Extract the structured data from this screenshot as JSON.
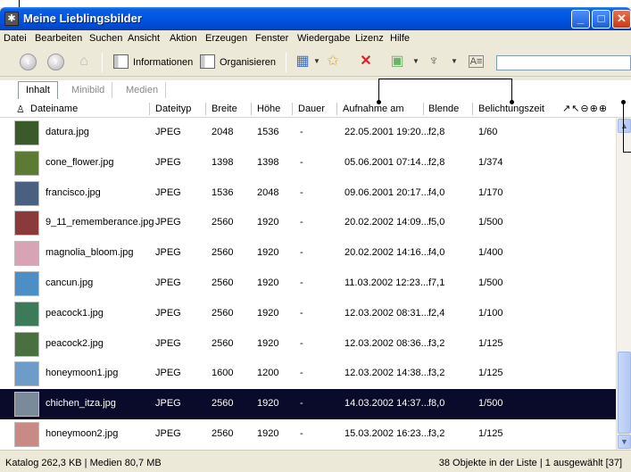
{
  "window": {
    "title": "Meine Lieblingsbilder",
    "title_icon": "✱",
    "controls": {
      "minimize": "_",
      "maximize": "□",
      "close": "✕"
    }
  },
  "menu": [
    "Datei",
    "Bearbeiten",
    "Suchen",
    "Ansicht",
    "Aktion",
    "Erzeugen",
    "Fenster",
    "Wiedergabe",
    "Lizenz",
    "Hilfe"
  ],
  "toolbar": {
    "info_label": "Informationen",
    "organize_label": "Organisieren",
    "icons": [
      "back-icon",
      "forward-icon",
      "home-icon",
      "calendar-icon",
      "folder-star-icon",
      "delete-icon",
      "lock-icon",
      "microphone-icon",
      "caption-icon"
    ]
  },
  "tabs": [
    "Inhalt",
    "Minibild",
    "Medien"
  ],
  "columns": [
    "Dateiname",
    "Dateityp",
    "Breite",
    "Höhe",
    "Dauer",
    "Aufnahme am",
    "Blende",
    "Belichtungszeit"
  ],
  "header_tools": "↗↖⊖⊕⊕",
  "rows": [
    {
      "name": "datura.jpg",
      "type": "JPEG",
      "width": "2048",
      "height": "1536",
      "duration": "-",
      "date": "22.05.2001 19:20...",
      "aperture": "f2,8",
      "exposure": "1/60",
      "thumb_color": "#3a5a2a",
      "selected": false
    },
    {
      "name": "cone_flower.jpg",
      "type": "JPEG",
      "width": "1398",
      "height": "1398",
      "duration": "-",
      "date": "05.06.2001 07:14...",
      "aperture": "f2,8",
      "exposure": "1/374",
      "thumb_color": "#5d7a34",
      "selected": false
    },
    {
      "name": "francisco.jpg",
      "type": "JPEG",
      "width": "1536",
      "height": "2048",
      "duration": "-",
      "date": "09.06.2001 20:17...",
      "aperture": "f4,0",
      "exposure": "1/170",
      "thumb_color": "#4a6080",
      "selected": false
    },
    {
      "name": "9_11_rememberance.jpg",
      "type": "JPEG",
      "width": "2560",
      "height": "1920",
      "duration": "-",
      "date": "20.02.2002 14:09...",
      "aperture": "f5,0",
      "exposure": "1/500",
      "thumb_color": "#8a3a3a",
      "selected": false
    },
    {
      "name": "magnolia_bloom.jpg",
      "type": "JPEG",
      "width": "2560",
      "height": "1920",
      "duration": "-",
      "date": "20.02.2002 14:16...",
      "aperture": "f4,0",
      "exposure": "1/400",
      "thumb_color": "#d7a3b5",
      "selected": false
    },
    {
      "name": "cancun.jpg",
      "type": "JPEG",
      "width": "2560",
      "height": "1920",
      "duration": "-",
      "date": "11.03.2002 12:23...",
      "aperture": "f7,1",
      "exposure": "1/500",
      "thumb_color": "#4d8fc4",
      "selected": false
    },
    {
      "name": "peacock1.jpg",
      "type": "JPEG",
      "width": "2560",
      "height": "1920",
      "duration": "-",
      "date": "12.03.2002 08:31...",
      "aperture": "f2,4",
      "exposure": "1/100",
      "thumb_color": "#3c7a5a",
      "selected": false
    },
    {
      "name": "peacock2.jpg",
      "type": "JPEG",
      "width": "2560",
      "height": "1920",
      "duration": "-",
      "date": "12.03.2002 08:36...",
      "aperture": "f3,2",
      "exposure": "1/125",
      "thumb_color": "#4b7040",
      "selected": false
    },
    {
      "name": "honeymoon1.jpg",
      "type": "JPEG",
      "width": "1600",
      "height": "1200",
      "duration": "-",
      "date": "12.03.2002 14:38...",
      "aperture": "f3,2",
      "exposure": "1/125",
      "thumb_color": "#6e9cc8",
      "selected": false
    },
    {
      "name": "chichen_itza.jpg",
      "type": "JPEG",
      "width": "2560",
      "height": "1920",
      "duration": "-",
      "date": "14.03.2002 14:37...",
      "aperture": "f8,0",
      "exposure": "1/500",
      "thumb_color": "#7a8a9a",
      "selected": true
    },
    {
      "name": "honeymoon2.jpg",
      "type": "JPEG",
      "width": "2560",
      "height": "1920",
      "duration": "-",
      "date": "15.03.2002 16:23...",
      "aperture": "f3,2",
      "exposure": "1/125",
      "thumb_color": "#c98a86",
      "selected": false
    }
  ],
  "status": {
    "left": "Katalog  262,3 KB  |  Medien 80,7 MB",
    "right": "38 Objekte in der Liste  |  1 ausgewählt [37]"
  },
  "colors": {
    "title_bar": "#0055e5",
    "selection": "#0a0a2a"
  }
}
